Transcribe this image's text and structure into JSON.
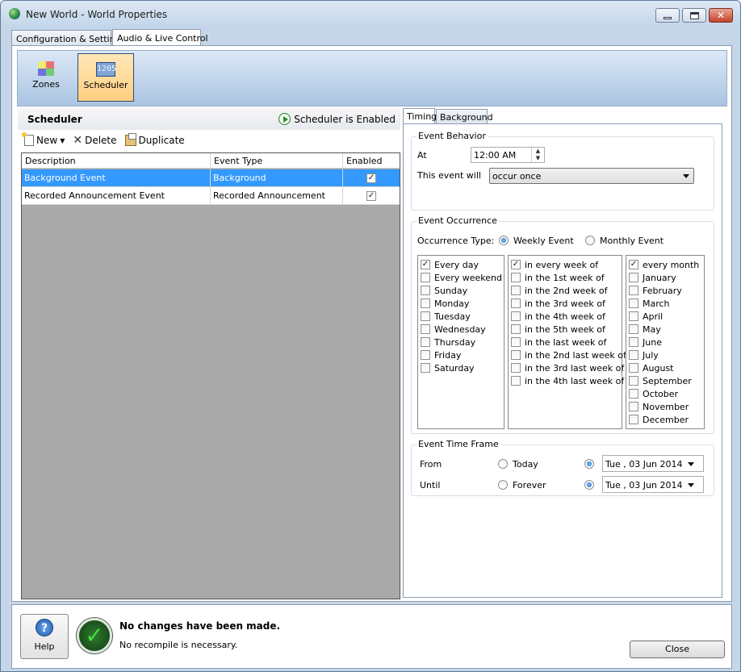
{
  "window": {
    "title": "New World - World Properties"
  },
  "top_tabs": [
    "Configuration & Settings",
    "Audio & Live Control"
  ],
  "ribbon": {
    "zones_label": "Zones",
    "scheduler_label": "Scheduler",
    "scheduler_icon_text": "1205"
  },
  "scheduler": {
    "title": "Scheduler",
    "status": "Scheduler is Enabled",
    "toolbar": {
      "new": "New",
      "delete": "Delete",
      "duplicate": "Duplicate"
    },
    "columns": [
      "Description",
      "Event Type",
      "Enabled"
    ],
    "rows": [
      {
        "description": "Background Event",
        "type": "Background",
        "enabled": true,
        "selected": true
      },
      {
        "description": "Recorded Announcement Event",
        "type": "Recorded Announcement",
        "enabled": true,
        "selected": false
      }
    ]
  },
  "right_tabs": [
    "Timing",
    "Background"
  ],
  "event_behavior": {
    "title": "Event Behavior",
    "at_label": "At",
    "time": "12:00 AM",
    "will_label": "This event will",
    "will_value": "occur once"
  },
  "event_occurrence": {
    "title": "Event Occurrence",
    "type_label": "Occurrence Type:",
    "weekly": "Weekly Event",
    "monthly": "Monthly Event",
    "days": [
      {
        "label": "Every day",
        "checked": true
      },
      {
        "label": "Every weekend",
        "checked": false
      },
      {
        "label": "Sunday",
        "checked": false
      },
      {
        "label": "Monday",
        "checked": false
      },
      {
        "label": "Tuesday",
        "checked": false
      },
      {
        "label": "Wednesday",
        "checked": false
      },
      {
        "label": "Thursday",
        "checked": false
      },
      {
        "label": "Friday",
        "checked": false
      },
      {
        "label": "Saturday",
        "checked": false
      }
    ],
    "weeks": [
      {
        "label": "in every week of",
        "checked": true
      },
      {
        "label": "in the 1st week of",
        "checked": false
      },
      {
        "label": "in the 2nd week of",
        "checked": false
      },
      {
        "label": "in the 3rd week of",
        "checked": false
      },
      {
        "label": "in the 4th week of",
        "checked": false
      },
      {
        "label": "in the 5th week of",
        "checked": false
      },
      {
        "label": "in the last week of",
        "checked": false
      },
      {
        "label": "in the 2nd last week of",
        "checked": false
      },
      {
        "label": "in the 3rd last week of",
        "checked": false
      },
      {
        "label": "in the 4th last week of",
        "checked": false
      }
    ],
    "months": [
      {
        "label": "every month",
        "checked": true
      },
      {
        "label": "January",
        "checked": false
      },
      {
        "label": "February",
        "checked": false
      },
      {
        "label": "March",
        "checked": false
      },
      {
        "label": "April",
        "checked": false
      },
      {
        "label": "May",
        "checked": false
      },
      {
        "label": "June",
        "checked": false
      },
      {
        "label": "July",
        "checked": false
      },
      {
        "label": "August",
        "checked": false
      },
      {
        "label": "September",
        "checked": false
      },
      {
        "label": "October",
        "checked": false
      },
      {
        "label": "November",
        "checked": false
      },
      {
        "label": "December",
        "checked": false
      }
    ]
  },
  "time_frame": {
    "title": "Event Time Frame",
    "from_label": "From",
    "today": "Today",
    "from_date": "Tue , 03 Jun  2014",
    "until_label": "Until",
    "forever": "Forever",
    "until_date": "Tue , 03 Jun  2014"
  },
  "status": {
    "help": "Help",
    "message": "No changes have been made.",
    "sub": "No recompile is necessary.",
    "close": "Close"
  }
}
